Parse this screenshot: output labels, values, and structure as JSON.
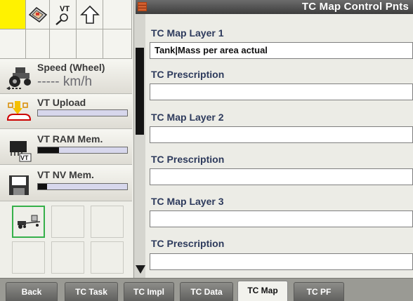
{
  "header": {
    "title": "TC Map Control Pnts"
  },
  "top_grid": {
    "vt_label": "VT"
  },
  "panels": {
    "speed": {
      "title": "Speed (Wheel)",
      "value": "----- km/h"
    },
    "vt_upload": {
      "title": "VT Upload",
      "progress": 0.0
    },
    "vt_ram": {
      "title": "VT RAM Mem.",
      "progress": 0.24
    },
    "vt_nv": {
      "title": "VT NV Mem.",
      "progress": 0.1
    }
  },
  "form": {
    "fields": [
      {
        "label": "TC Map Layer 1",
        "value": "Tank|Mass per area actual"
      },
      {
        "label": "TC Prescription",
        "value": ""
      },
      {
        "label": "TC Map Layer 2",
        "value": ""
      },
      {
        "label": "TC Prescription",
        "value": ""
      },
      {
        "label": "TC Map Layer 3",
        "value": ""
      },
      {
        "label": "TC Prescription",
        "value": ""
      }
    ]
  },
  "tabs": [
    {
      "label": "Back",
      "active": false
    },
    {
      "label": "TC Task",
      "active": false
    },
    {
      "label": "TC Impl",
      "active": false
    },
    {
      "label": "TC Data",
      "active": false
    },
    {
      "label": "TC Map",
      "active": true
    },
    {
      "label": "TC PF",
      "active": false
    }
  ],
  "colors": {
    "accent_yellow": "#fff200",
    "selected_green": "#36b04a",
    "title_bar": "#4d4d4d"
  }
}
